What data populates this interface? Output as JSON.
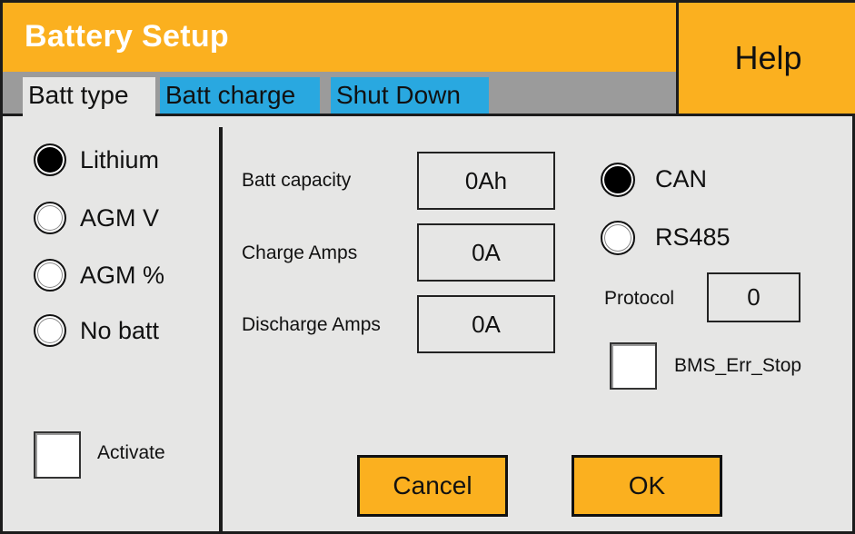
{
  "header": {
    "title": "Battery Setup",
    "help_label": "Help"
  },
  "tabs": [
    {
      "label": "Batt type",
      "active": true
    },
    {
      "label": "Batt charge",
      "active": false
    },
    {
      "label": "Shut Down",
      "active": false
    }
  ],
  "battery_types": [
    {
      "label": "Lithium",
      "selected": true
    },
    {
      "label": "AGM V",
      "selected": false
    },
    {
      "label": "AGM %",
      "selected": false
    },
    {
      "label": "No batt",
      "selected": false
    }
  ],
  "activate": {
    "label": "Activate",
    "checked": false
  },
  "fields": {
    "capacity": {
      "label": "Batt capacity",
      "value": "0Ah"
    },
    "charge": {
      "label": "Charge Amps",
      "value": "0A"
    },
    "discharge": {
      "label": "Discharge Amps",
      "value": "0A"
    }
  },
  "comm": [
    {
      "label": "CAN",
      "selected": true
    },
    {
      "label": "RS485",
      "selected": false
    }
  ],
  "protocol": {
    "label": "Protocol",
    "value": "0"
  },
  "bms_err_stop": {
    "label": "BMS_Err_Stop",
    "checked": false
  },
  "actions": {
    "cancel_label": "Cancel",
    "ok_label": "OK"
  },
  "colors": {
    "accent": "#fbb01f",
    "tab_blue": "#29a8e0",
    "panel": "#e6e6e5",
    "tabstrip": "#9b9b9b"
  }
}
